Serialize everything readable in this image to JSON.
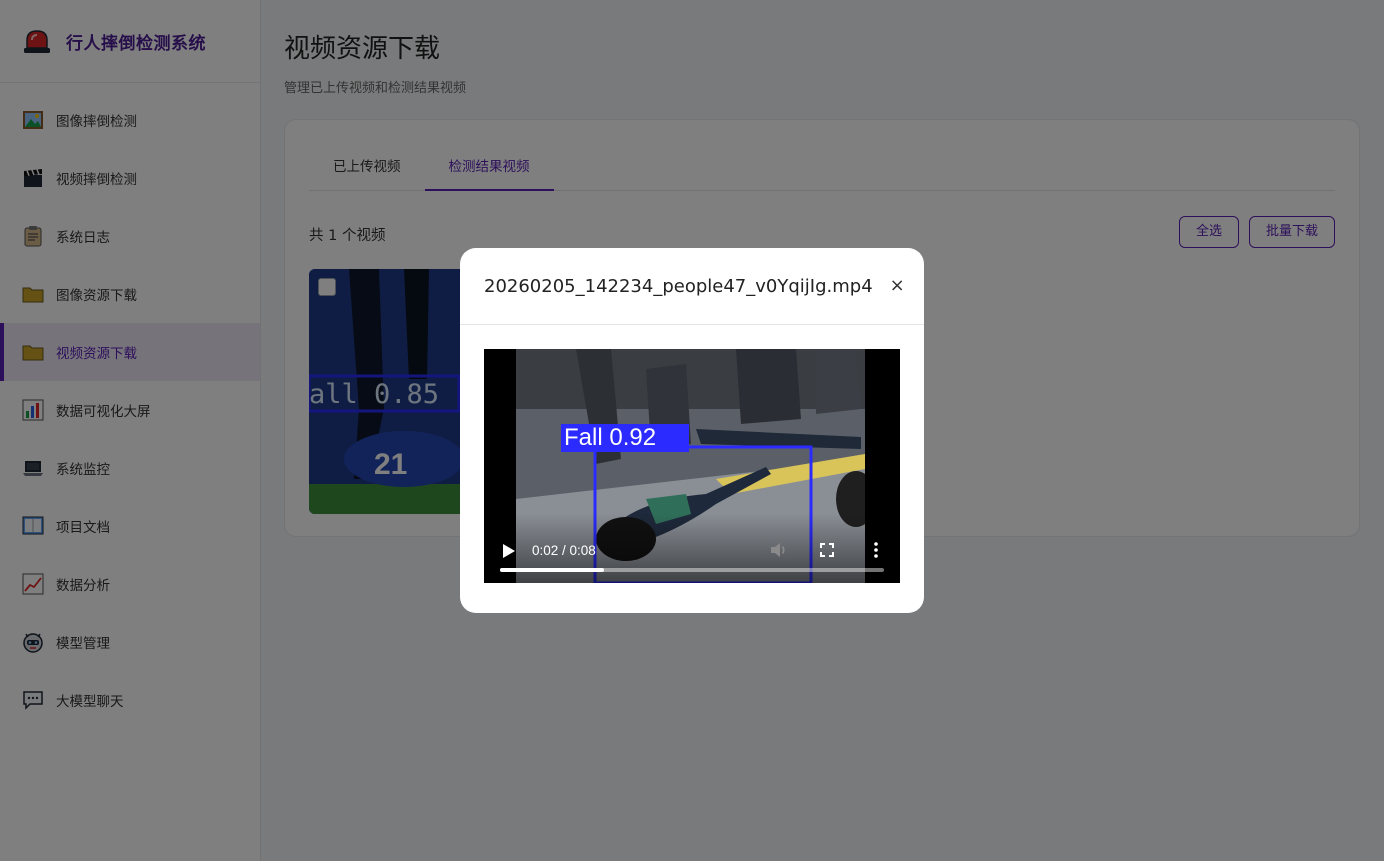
{
  "brand": {
    "title": "行人摔倒检测系统",
    "logo_icon": "alarm-siren-icon"
  },
  "sidebar": {
    "items": [
      {
        "label": "图像摔倒检测",
        "icon": "picture-icon",
        "active": false
      },
      {
        "label": "视频摔倒检测",
        "icon": "clapperboard-icon",
        "active": false
      },
      {
        "label": "系统日志",
        "icon": "clipboard-icon",
        "active": false
      },
      {
        "label": "图像资源下载",
        "icon": "folder-icon",
        "active": false
      },
      {
        "label": "视频资源下载",
        "icon": "folder-icon",
        "active": true
      },
      {
        "label": "数据可视化大屏",
        "icon": "bar-chart-icon",
        "active": false
      },
      {
        "label": "系统监控",
        "icon": "laptop-icon",
        "active": false
      },
      {
        "label": "项目文档",
        "icon": "book-icon",
        "active": false
      },
      {
        "label": "数据分析",
        "icon": "line-chart-icon",
        "active": false
      },
      {
        "label": "模型管理",
        "icon": "robot-icon",
        "active": false
      },
      {
        "label": "大模型聊天",
        "icon": "chat-bubble-icon",
        "active": false
      }
    ]
  },
  "main": {
    "title": "视频资源下载",
    "subtitle": "管理已上传视频和检测结果视频",
    "tabs": [
      {
        "label": "已上传视频",
        "active": false
      },
      {
        "label": "检测结果视频",
        "active": true
      }
    ],
    "count_text": "共 1 个视频",
    "select_all_label": "全选",
    "batch_download_label": "批量下载",
    "thumbnail": {
      "detection_label": "all 0.85"
    }
  },
  "modal": {
    "title": "20260205_142234_people47_v0YqijIg.mp4",
    "close_glyph": "×",
    "video": {
      "time_text": "0:02 / 0:08",
      "progress": 0.27,
      "detection_label": "Fall 0.92"
    }
  },
  "colors": {
    "accent": "#5b21b6",
    "brand": "#4c1d95",
    "detection_box": "#2b2bff"
  }
}
